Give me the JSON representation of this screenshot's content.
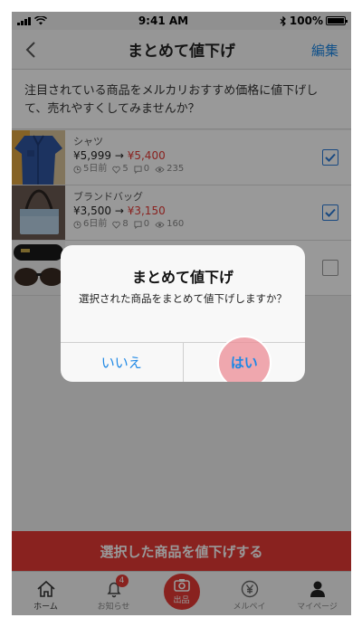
{
  "status": {
    "time": "9:41 AM",
    "battery": "100%"
  },
  "nav": {
    "title": "まとめて値下げ",
    "edit_label": "編集"
  },
  "banner": {
    "text": "注目されている商品をメルカリおすすめ価格に値下げして、売れやすくしてみませんか？"
  },
  "items": [
    {
      "name": "シャツ",
      "old_price": "¥5,999",
      "arrow": "→",
      "new_price": "¥5,400",
      "age": "5日前",
      "likes": "5",
      "comments": "0",
      "views": "235",
      "checked": true
    },
    {
      "name": "ブランドバッグ",
      "old_price": "¥3,500",
      "arrow": "→",
      "new_price": "¥3,150",
      "age": "6日前",
      "likes": "8",
      "comments": "0",
      "views": "160",
      "checked": true
    },
    {
      "checked": false
    }
  ],
  "action": {
    "label": "選択した商品を値下げする"
  },
  "tabs": [
    {
      "label": "ホーム",
      "icon": "home-icon"
    },
    {
      "label": "お知らせ",
      "icon": "bell-icon",
      "badge": "4"
    },
    {
      "label": "出品",
      "icon": "camera-icon"
    },
    {
      "label": "メルペイ",
      "icon": "yen-icon"
    },
    {
      "label": "マイページ",
      "icon": "person-icon"
    }
  ],
  "dialog": {
    "title": "まとめて値下げ",
    "message": "選択された商品をまとめて値下げしますか？",
    "cancel_label": "いいえ",
    "confirm_label": "はい"
  },
  "colors": {
    "accent": "#e53935",
    "link": "#1e88e5"
  }
}
